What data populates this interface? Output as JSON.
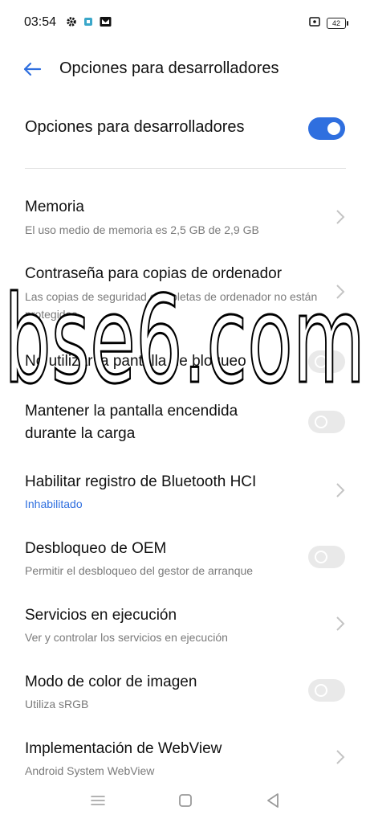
{
  "status_bar": {
    "time": "03:54",
    "left_icons": [
      "gear-icon",
      "app-notification-icon",
      "mail-icon"
    ],
    "right_icons": [
      "screen-icon",
      "battery-icon"
    ],
    "battery_level": "42"
  },
  "app_bar": {
    "title": "Opciones para desarrolladores",
    "back_icon": "arrow-left-icon",
    "accent_color": "#2f6fdf"
  },
  "master_toggle": {
    "label": "Opciones para desarrolladores",
    "enabled": true
  },
  "items": [
    {
      "title": "Memoria",
      "subtitle": "El uso medio de memoria es 2,5 GB de 2,9 GB",
      "control": "chevron"
    },
    {
      "title": "Contraseña para copias de ordenador",
      "subtitle": "Las copias de seguridad completas de ordenador no están protegidas",
      "control": "chevron"
    },
    {
      "title": "No utilizar la pantalla de bloqueo",
      "subtitle": "",
      "control": "toggle",
      "enabled": false
    },
    {
      "title": "Mantener la pantalla encendida durante la carga",
      "subtitle": "",
      "control": "toggle",
      "enabled": false
    },
    {
      "title": "Habilitar registro de Bluetooth HCI",
      "subtitle": "Inhabilitado",
      "control": "chevron"
    },
    {
      "title": "Desbloqueo de OEM",
      "subtitle": "Permitir el desbloqueo del gestor de arranque",
      "control": "toggle",
      "enabled": false
    },
    {
      "title": "Servicios en ejecución",
      "subtitle": "Ver y controlar los servicios en ejecución",
      "control": "chevron"
    },
    {
      "title": "Modo de color de imagen",
      "subtitle": "Utiliza sRGB",
      "control": "toggle",
      "enabled": false
    },
    {
      "title": "Implementación de WebView",
      "subtitle": "Android System WebView",
      "control": "chevron"
    }
  ],
  "watermark": {
    "text": "bse6.com"
  },
  "nav_bar": {
    "icons": [
      "menu-icon",
      "home-icon",
      "back-triangle-icon"
    ]
  }
}
